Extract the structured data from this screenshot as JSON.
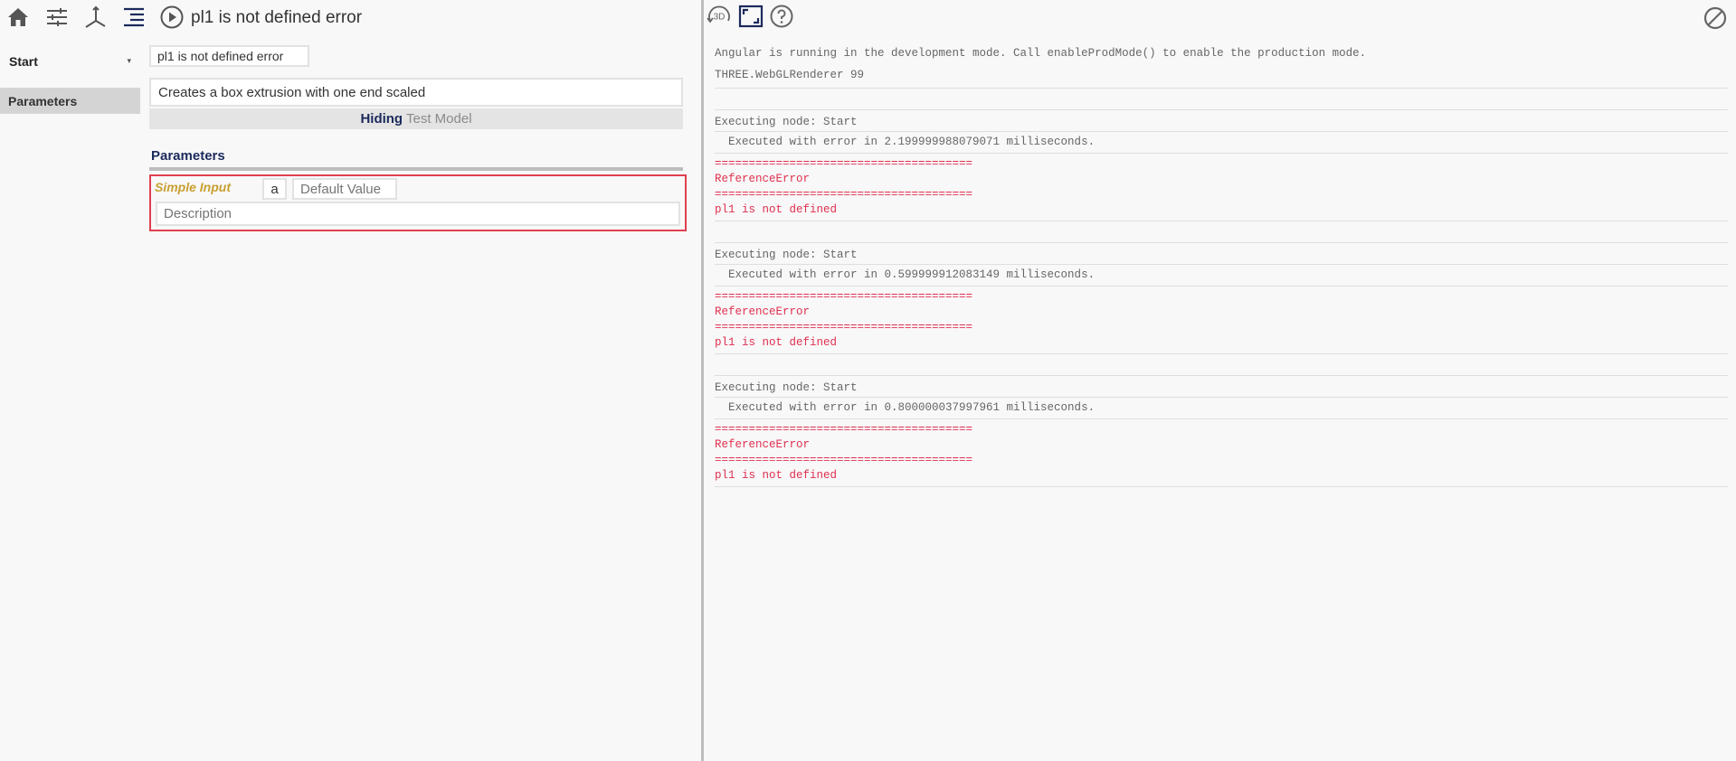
{
  "toolbar": {
    "icons": [
      "home-icon",
      "sliders-icon",
      "axis-icon",
      "indent-list-icon",
      "play-circle-icon"
    ],
    "node_title": "pl1 is not defined error"
  },
  "sidebar": {
    "start_label": "Start",
    "caret": "▾",
    "params_label": "Parameters"
  },
  "main": {
    "name_value": "pl1 is not defined error",
    "description_value": "Creates a box extrusion with one end scaled",
    "hiding_label": "Hiding",
    "test_model_label": "Test Model",
    "parameters_heading": "Parameters",
    "param": {
      "type_label": "Simple Input",
      "name_value": "a",
      "default_placeholder": "Default Value",
      "description_placeholder": "Description"
    }
  },
  "right_toolbar": {
    "icons": [
      "3d-rotate-icon",
      "fullscreen-icon",
      "help-icon",
      "block-icon"
    ],
    "three_d_label": "3D"
  },
  "console": {
    "angular_msg": "Angular is running in the development mode. Call enableProdMode() to enable the production mode.",
    "three_msg": "THREE.WebGLRenderer 99",
    "runs": [
      {
        "exec": "Executing node: Start",
        "result": "Executed with error in 2.199999988079071 milliseconds.",
        "rule1": "======================================",
        "error_type": "ReferenceError",
        "rule2": "======================================",
        "error_msg": "pl1 is not defined"
      },
      {
        "exec": "Executing node: Start",
        "result": "Executed with error in 0.599999912083149 milliseconds.",
        "rule1": "======================================",
        "error_type": "ReferenceError",
        "rule2": "======================================",
        "error_msg": "pl1 is not defined"
      },
      {
        "exec": "Executing node: Start",
        "result": "Executed with error in 0.800000037997961 milliseconds.",
        "rule1": "======================================",
        "error_type": "ReferenceError",
        "rule2": "======================================",
        "error_msg": "pl1 is not defined"
      }
    ]
  },
  "colors": {
    "accent_navy": "#1b2a5c",
    "error_red": "#e03050",
    "param_type_gold": "#c8a030"
  }
}
